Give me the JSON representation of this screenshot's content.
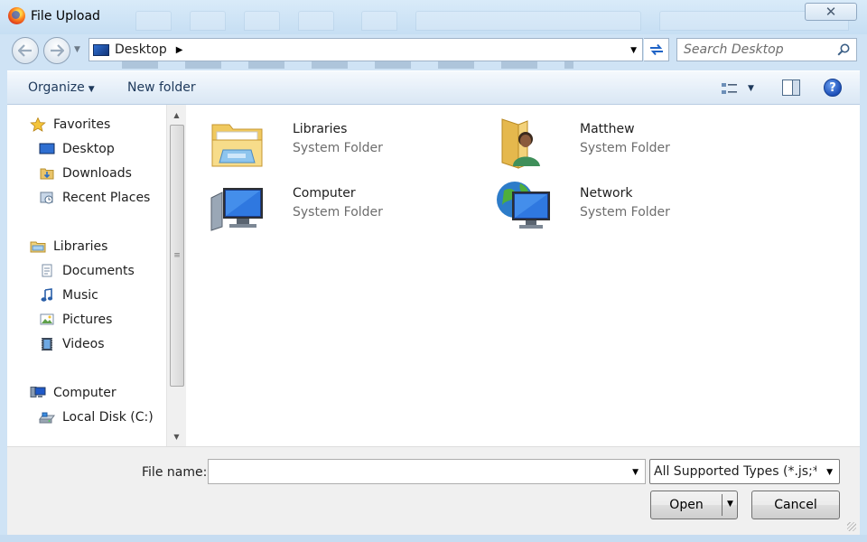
{
  "window": {
    "title": "File Upload",
    "close_glyph": "✕"
  },
  "address": {
    "location": "Desktop",
    "search_placeholder": "Search Desktop"
  },
  "toolbar": {
    "organize": "Organize",
    "new_folder": "New folder",
    "help_glyph": "?"
  },
  "nav": {
    "favorites": {
      "label": "Favorites",
      "icon": "star-icon"
    },
    "favorites_items": [
      {
        "label": "Desktop",
        "icon": "desktop-icon"
      },
      {
        "label": "Downloads",
        "icon": "downloads-folder-icon"
      },
      {
        "label": "Recent Places",
        "icon": "recent-places-icon"
      }
    ],
    "libraries": {
      "label": "Libraries",
      "icon": "libraries-icon"
    },
    "libraries_items": [
      {
        "label": "Documents",
        "icon": "documents-icon"
      },
      {
        "label": "Music",
        "icon": "music-icon"
      },
      {
        "label": "Pictures",
        "icon": "pictures-icon"
      },
      {
        "label": "Videos",
        "icon": "videos-icon"
      }
    ],
    "computer": {
      "label": "Computer",
      "icon": "computer-icon"
    },
    "computer_items": [
      {
        "label": "Local Disk (C:)",
        "icon": "local-disk-icon"
      }
    ]
  },
  "content": {
    "items": [
      {
        "name": "Libraries",
        "type": "System Folder",
        "icon": "libraries-folder-icon"
      },
      {
        "name": "Matthew",
        "type": "System Folder",
        "icon": "user-folder-icon"
      },
      {
        "name": "Computer",
        "type": "System Folder",
        "icon": "computer-icon"
      },
      {
        "name": "Network",
        "type": "System Folder",
        "icon": "network-icon"
      }
    ]
  },
  "footer": {
    "file_name_label": "File name:",
    "file_name_value": "",
    "file_type": "All Supported Types (*.js;*.txt)",
    "open": "Open",
    "cancel": "Cancel"
  },
  "colors": {
    "accent": "#1e395b",
    "titlebar": "#cfe3f5",
    "secondary_text": "#6d6d6d"
  }
}
